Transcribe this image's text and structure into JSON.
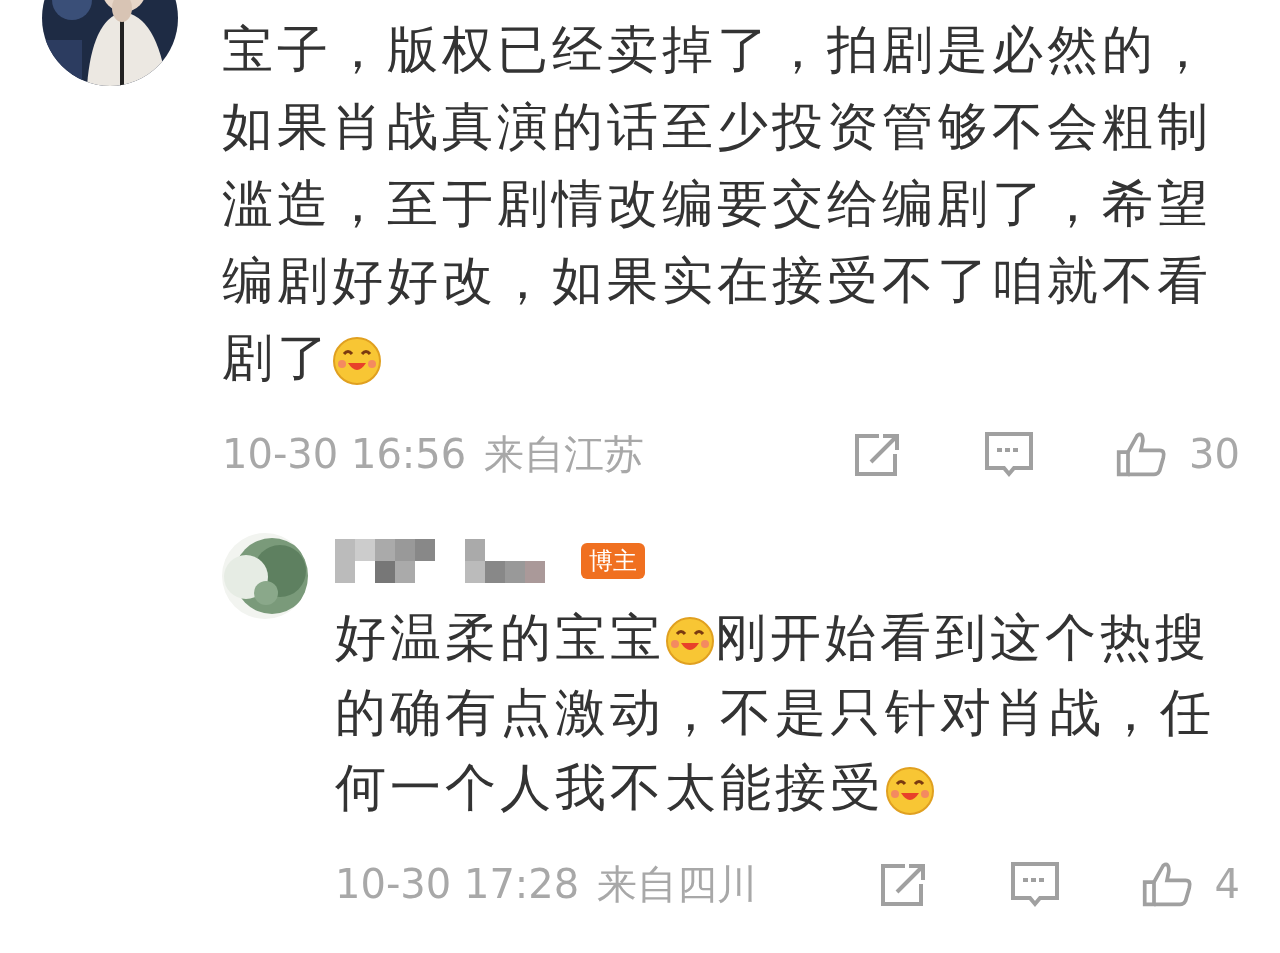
{
  "comment": {
    "avatar": {
      "kind": "picture"
    },
    "lines": [
      [
        {
          "kind": "text",
          "text": "宝子，版权已经卖掉了，拍剧是必然的，"
        }
      ],
      [
        {
          "kind": "text",
          "text": "如果肖战真演的话至少投资管够不会粗制"
        }
      ],
      [
        {
          "kind": "text",
          "text": "滥造，至于剧情改编要交给编剧了，希望"
        }
      ],
      [
        {
          "kind": "text",
          "text": "编剧好好改，如果实在接受不了咱就不看"
        }
      ],
      [
        {
          "kind": "text",
          "text": "剧了"
        },
        {
          "kind": "emoji"
        }
      ]
    ],
    "time": "10-30 16:56",
    "location": "来自江苏",
    "likes": "30",
    "reply": {
      "avatar": {
        "kind": "picture"
      },
      "badge": "博主",
      "lines": [
        [
          {
            "kind": "text",
            "text": "好温柔的宝宝"
          },
          {
            "kind": "emoji"
          },
          {
            "kind": "text",
            "text": "刚开始看到这个热搜"
          }
        ],
        [
          {
            "kind": "text",
            "text": "的确有点激动，不是只针对肖战，任"
          }
        ],
        [
          {
            "kind": "text",
            "text": "何一个人我不太能接受"
          },
          {
            "kind": "emoji"
          }
        ]
      ],
      "time": "10-30 17:28",
      "location": "来自四川",
      "likes": "4"
    }
  }
}
